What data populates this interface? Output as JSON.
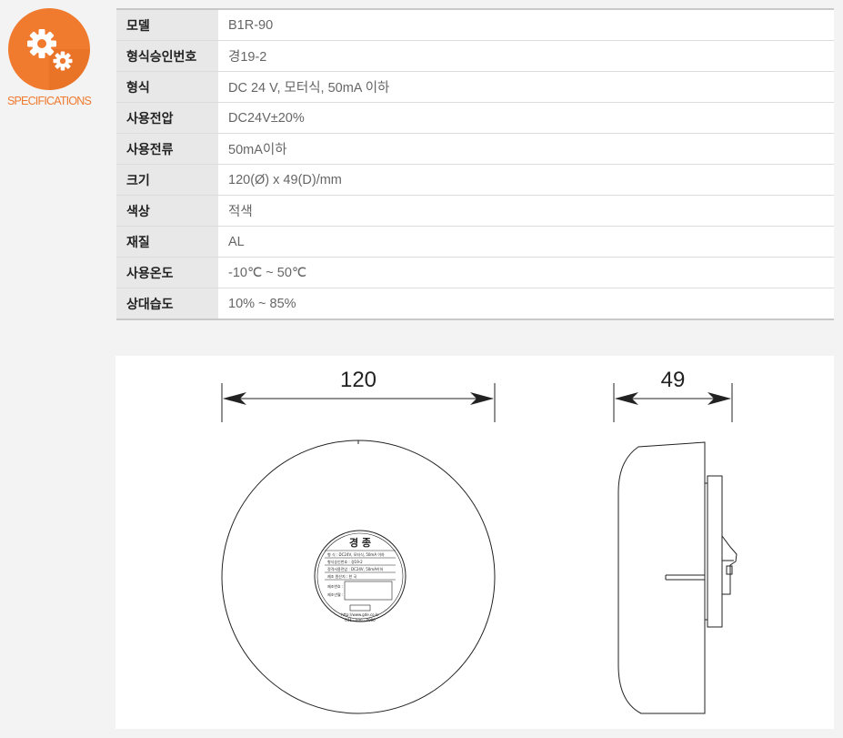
{
  "header": {
    "badge_label": "SPECIFICATIONS",
    "badge_color": "#f07a2e",
    "icon": "gears-icon"
  },
  "specs": [
    {
      "key": "모델",
      "value": "B1R-90"
    },
    {
      "key": "형식승인번호",
      "value": "경19-2"
    },
    {
      "key": "형식",
      "value": "DC 24 V, 모터식, 50mA 이하"
    },
    {
      "key": "사용전압",
      "value": "DC24V±20%"
    },
    {
      "key": "사용전류",
      "value": "50mA이하"
    },
    {
      "key": "크기",
      "value": "120(Ø) x 49(D)/mm"
    },
    {
      "key": "색상",
      "value": "적색"
    },
    {
      "key": "재질",
      "value": "AL"
    },
    {
      "key": "사용온도",
      "value": "-10℃ ~ 50℃"
    },
    {
      "key": "상대습도",
      "value": "10% ~ 85%"
    }
  ],
  "drawing": {
    "front_dim": "120",
    "side_dim": "49",
    "label": {
      "title": "경 종",
      "line1": "형 식 : DC24V, 모터식, 50mA 이하",
      "line2": "형식승인번호 : 경19-2",
      "line3": "정격사용전압 : DC24V, 50mA이하",
      "line4": "제조 원산지 : 한 국",
      "serial_label": "제조번호 :",
      "date_label": "제조년월 :",
      "url": "http://www.gde.co.kr",
      "phone": "031 - 000 - 0000"
    }
  }
}
